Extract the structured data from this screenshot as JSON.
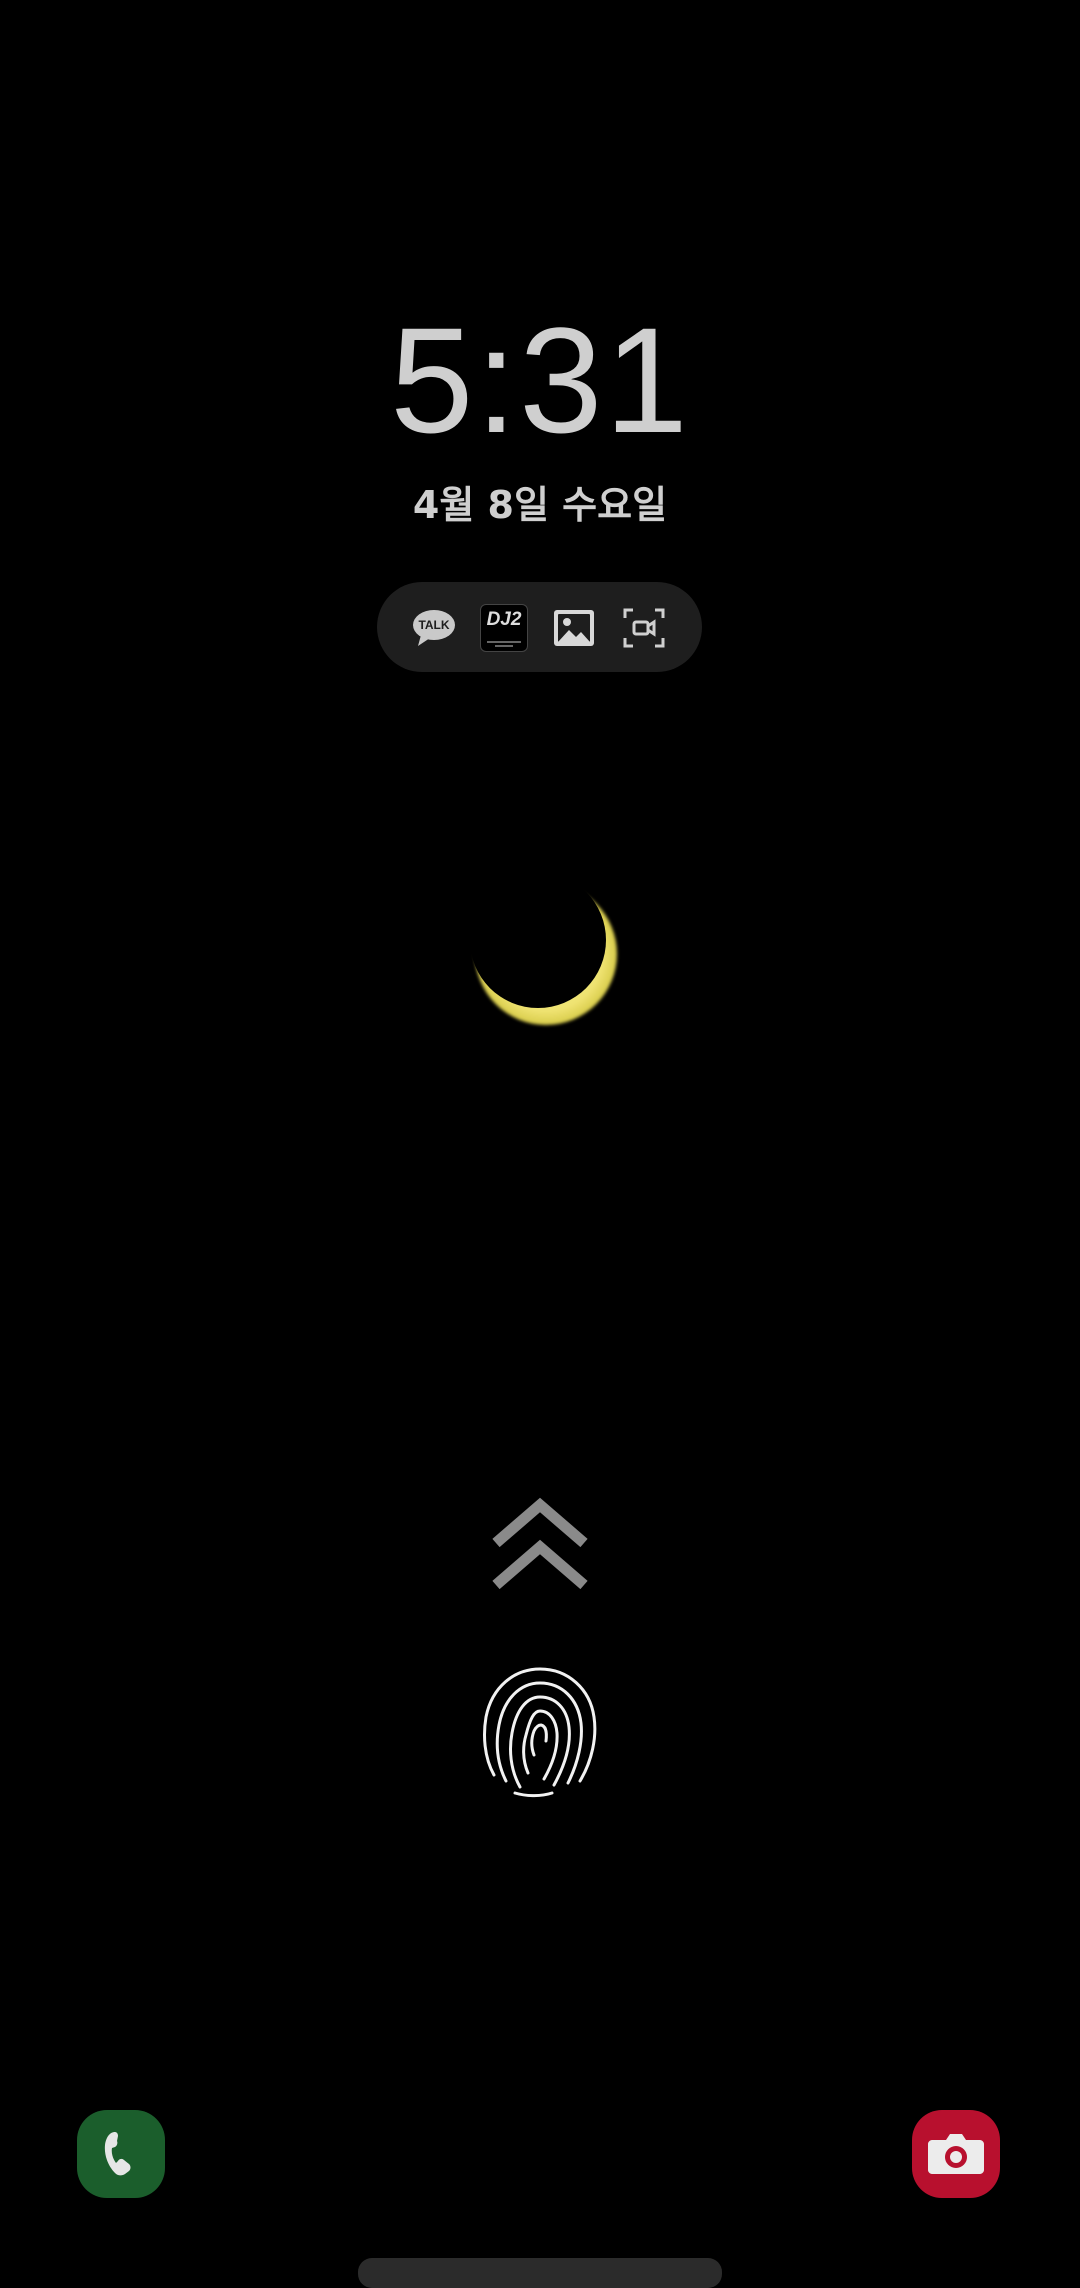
{
  "lockscreen": {
    "time": "5:31",
    "date": "4월 8일 수요일"
  },
  "notifications": {
    "icons": [
      {
        "name": "kakaotalk-icon",
        "label": "TALK"
      },
      {
        "name": "dj2-app-icon",
        "label": "DJ2"
      },
      {
        "name": "gallery-icon"
      },
      {
        "name": "screen-recorder-icon"
      }
    ]
  },
  "wallpaper": {
    "subject": "crescent-moon",
    "moon_color": "#f4ec7a",
    "background_color": "#000000"
  },
  "unlock": {
    "swipe_hint_icon": "double-chevron-up-icon",
    "fingerprint_icon": "fingerprint-icon"
  },
  "shortcuts": {
    "left": {
      "name": "phone-icon",
      "color": "#1b5e2c"
    },
    "right": {
      "name": "camera-icon",
      "color": "#b8102e"
    }
  }
}
